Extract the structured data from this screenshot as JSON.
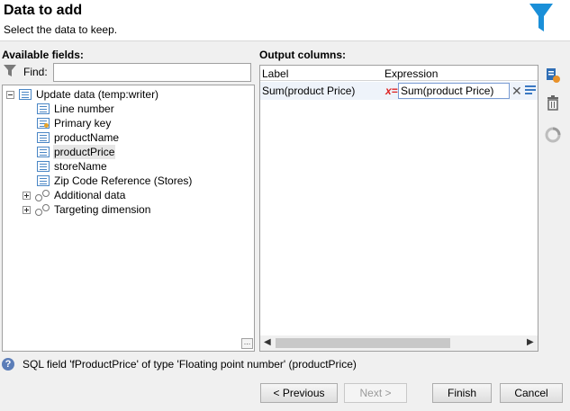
{
  "header": {
    "title": "Data to add",
    "subtitle": "Select the data to keep."
  },
  "available_fields": {
    "label": "Available fields:",
    "find_label": "Find:",
    "find_value": "",
    "tree": [
      {
        "label": "Update data (temp:writer)",
        "icon": "table-icon",
        "expander": "collapse"
      },
      {
        "label": "Line number",
        "icon": "field-icon"
      },
      {
        "label": "Primary key",
        "icon": "key-field-icon"
      },
      {
        "label": "productName",
        "icon": "field-icon"
      },
      {
        "label": "productPrice",
        "icon": "field-icon",
        "selected": true
      },
      {
        "label": "storeName",
        "icon": "field-icon"
      },
      {
        "label": "Zip Code Reference (Stores)",
        "icon": "field-icon"
      },
      {
        "label": "Additional data",
        "icon": "link-icon",
        "expander": "expand"
      },
      {
        "label": "Targeting dimension",
        "icon": "link-icon",
        "expander": "expand"
      }
    ]
  },
  "output_columns": {
    "label": "Output columns:",
    "headers": {
      "label": "Label",
      "expression": "Expression"
    },
    "rows": [
      {
        "label": "Sum(product Price)",
        "expression": "Sum(product Price)"
      }
    ]
  },
  "status": {
    "message": "SQL field 'fProductPrice' of type 'Floating point number' (productPrice)"
  },
  "buttons": {
    "previous": "< Previous",
    "next": "Next >",
    "finish": "Finish",
    "cancel": "Cancel"
  },
  "colors": {
    "accent": "#1a8fd8",
    "selected_row": "#eef3fa"
  }
}
